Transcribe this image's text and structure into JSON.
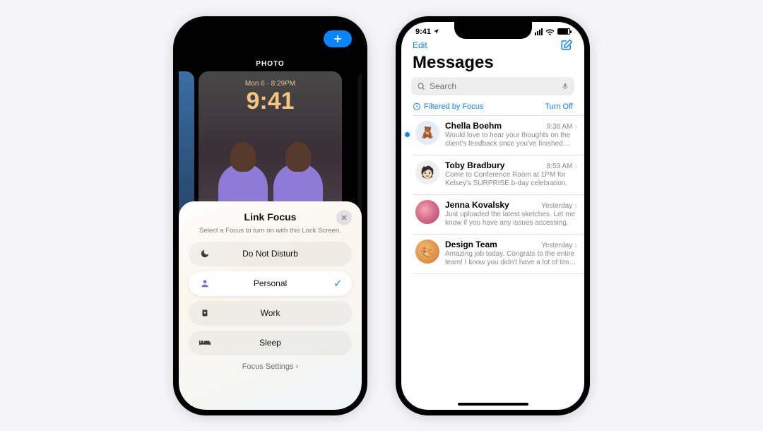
{
  "left": {
    "photo_label": "PHOTO",
    "lockscreen": {
      "date": "Mon 6 · 8:29PM",
      "time": "9:41"
    },
    "sheet": {
      "title": "Link Focus",
      "subtitle": "Select a Focus to turn on with this Lock Screen.",
      "items": [
        {
          "label": "Do Not Disturb"
        },
        {
          "label": "Personal"
        },
        {
          "label": "Work"
        },
        {
          "label": "Sleep"
        }
      ],
      "selected_index": 1,
      "footer": "Focus Settings"
    }
  },
  "right": {
    "statusbar": {
      "time": "9:41"
    },
    "nav": {
      "edit": "Edit"
    },
    "title": "Messages",
    "search_placeholder": "Search",
    "filter": {
      "label": "Filtered by Focus",
      "action": "Turn Off"
    },
    "threads": [
      {
        "name": "Chella Boehm",
        "time": "9:38 AM",
        "unread": true,
        "preview": "Would love to hear your thoughts on the client's feedback once you've finished th…"
      },
      {
        "name": "Toby Bradbury",
        "time": "8:53 AM",
        "unread": false,
        "preview": "Come to Conference Room at 1PM for Kelsey's SURPRISE b-day celebration."
      },
      {
        "name": "Jenna Kovalsky",
        "time": "Yesterday",
        "unread": false,
        "preview": "Just uploaded the latest sketches. Let me know if you have any issues accessing."
      },
      {
        "name": "Design Team",
        "time": "Yesterday",
        "unread": false,
        "preview": "Amazing job today. Congrats to the entire team! I know you didn't have a lot of tim…"
      }
    ]
  }
}
